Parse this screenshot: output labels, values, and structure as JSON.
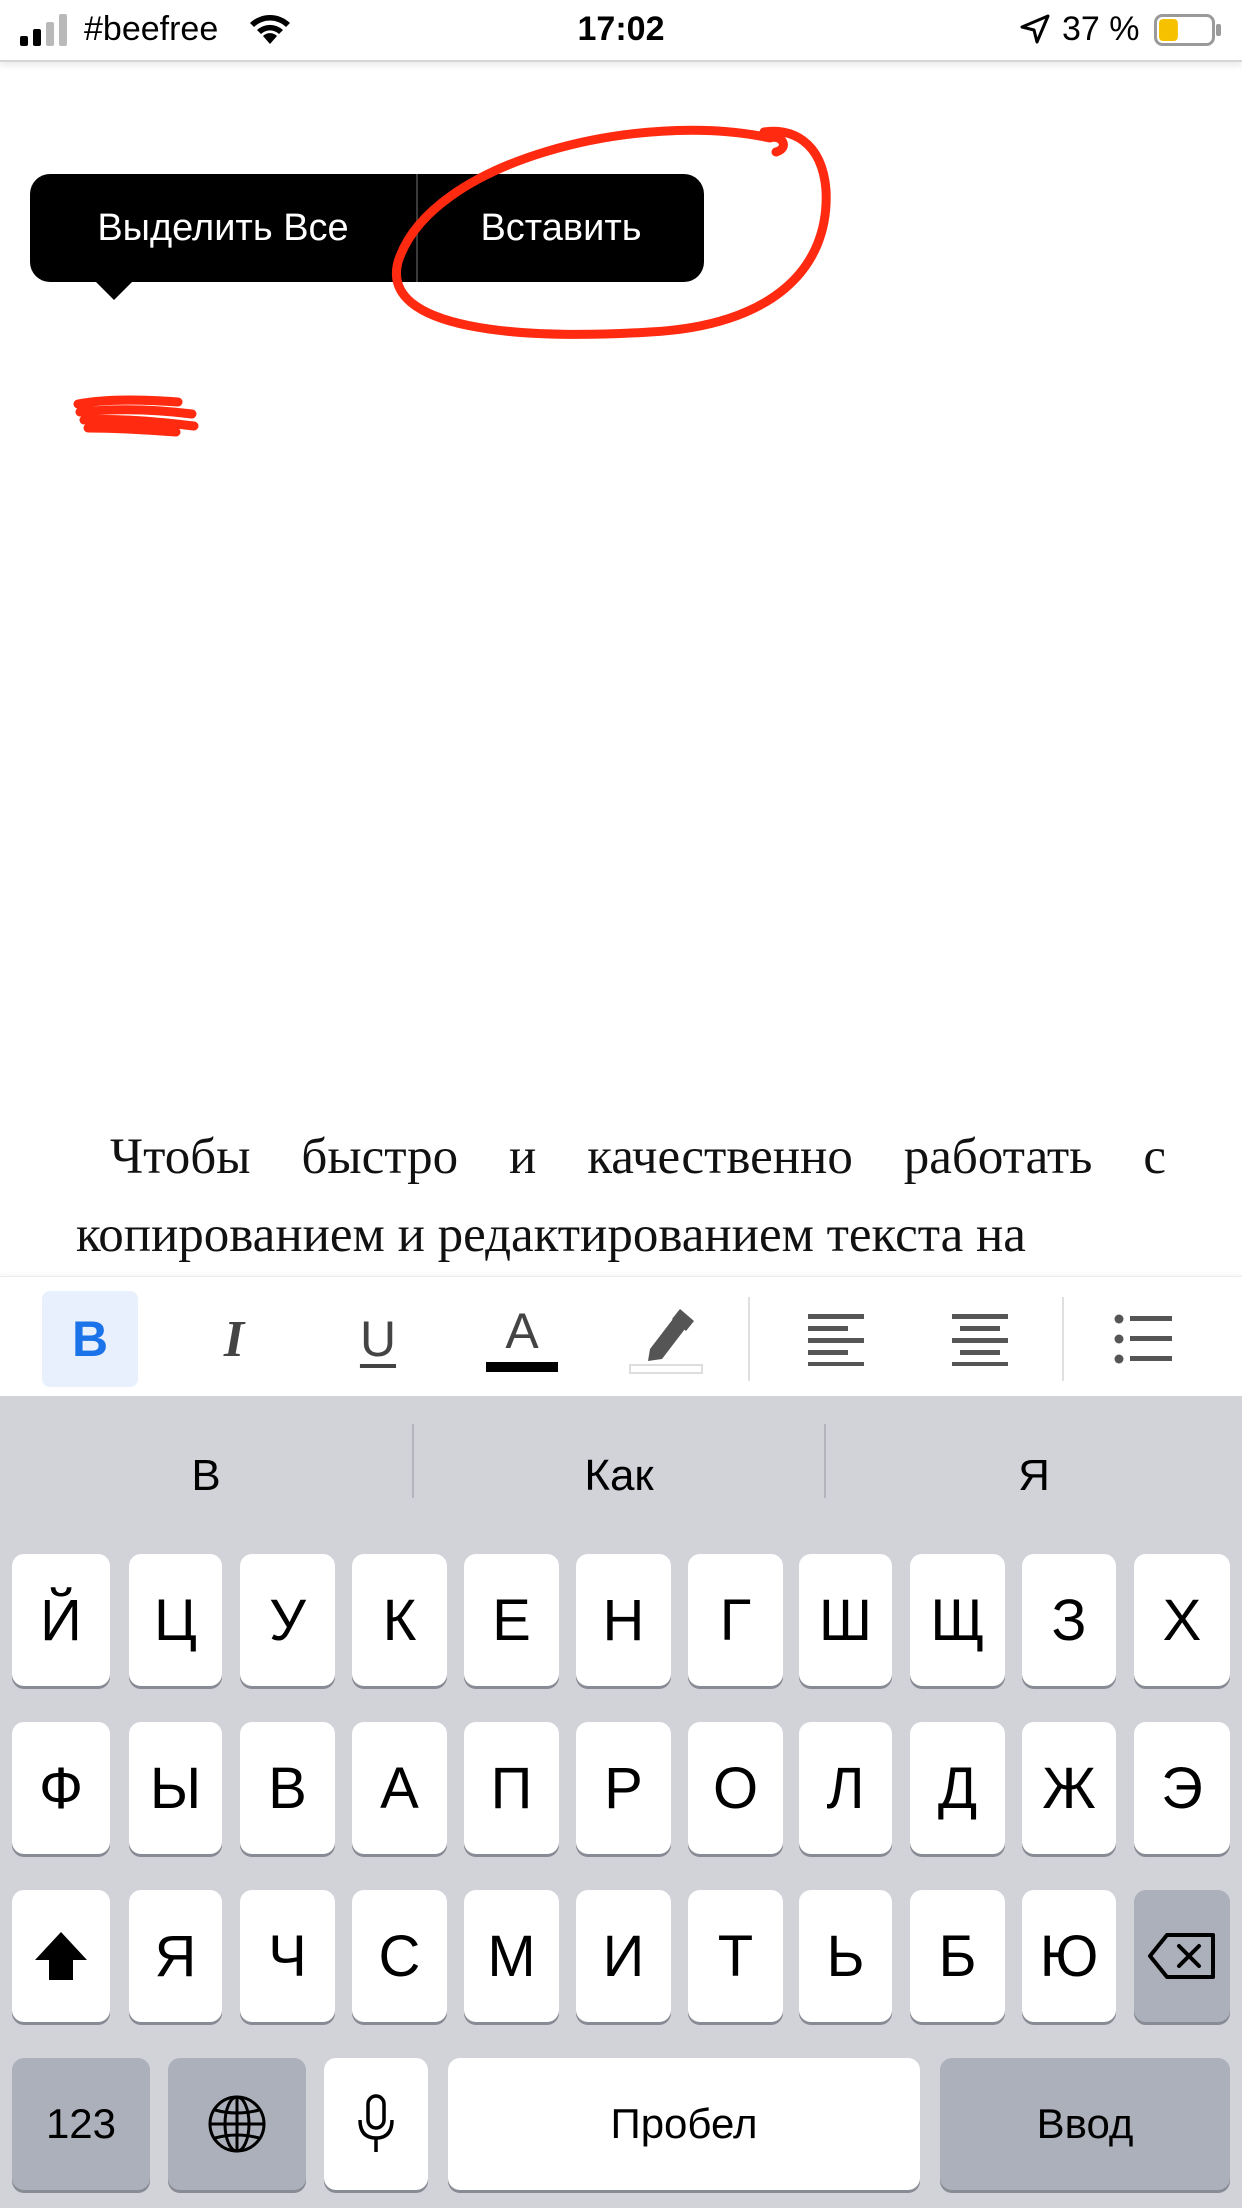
{
  "status_bar": {
    "carrier": "#beefree",
    "time": "17:02",
    "battery_percent": "37 %",
    "battery_level": 0.37,
    "battery_color": "#f6c200",
    "signal_bars_filled": 2
  },
  "context_menu": {
    "select_all_label": "Выделить Все",
    "paste_label": "Вставить"
  },
  "annotation": {
    "color": "#ff2a10"
  },
  "document": {
    "paragraph": "Чтобы быстро и качественно работать с копированием и редактированием текста на"
  },
  "toolbar": {
    "bold_label": "B",
    "italic_label": "I",
    "underline_label": "U",
    "text_color_label": "A",
    "accent_color": "#1a73e8"
  },
  "keyboard": {
    "suggestions": [
      "В",
      "Как",
      "Я"
    ],
    "row1": [
      "Й",
      "Ц",
      "У",
      "К",
      "Е",
      "Н",
      "Г",
      "Ш",
      "Щ",
      "З",
      "Х"
    ],
    "row2": [
      "Ф",
      "Ы",
      "В",
      "А",
      "П",
      "Р",
      "О",
      "Л",
      "Д",
      "Ж",
      "Э"
    ],
    "row3": [
      "Я",
      "Ч",
      "С",
      "М",
      "И",
      "Т",
      "Ь",
      "Б",
      "Ю"
    ],
    "numbers_label": "123",
    "space_label": "Пробел",
    "return_label": "Ввод"
  }
}
